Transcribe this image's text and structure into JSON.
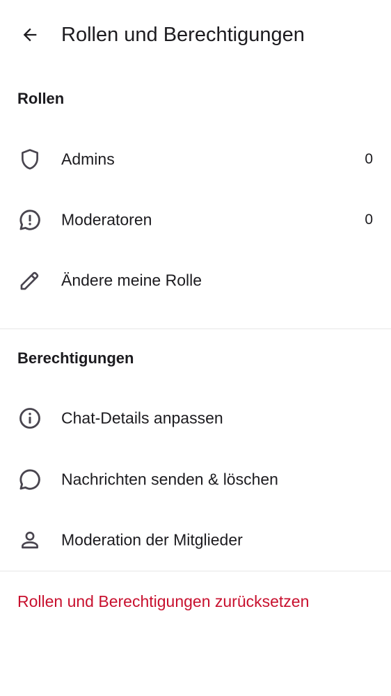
{
  "header": {
    "title": "Rollen und Berechtigungen",
    "back_icon": "arrow-back-icon"
  },
  "roles": {
    "header": "Rollen",
    "items": [
      {
        "icon": "shield-icon",
        "label": "Admins",
        "count": "0"
      },
      {
        "icon": "alert-chat-icon",
        "label": "Moderatoren",
        "count": "0"
      },
      {
        "icon": "pencil-icon",
        "label": "Ändere meine Rolle"
      }
    ]
  },
  "permissions": {
    "header": "Berechtigungen",
    "items": [
      {
        "icon": "info-icon",
        "label": "Chat-Details anpassen"
      },
      {
        "icon": "chat-bubble-icon",
        "label": "Nachrichten senden & löschen"
      },
      {
        "icon": "person-icon",
        "label": "Moderation der Mitglieder"
      }
    ]
  },
  "reset": {
    "label": "Rollen und Berechtigungen zurücksetzen"
  },
  "colors": {
    "text": "#1c1b1f",
    "icon": "#49454f",
    "danger": "#c8102e",
    "divider": "#e6e6e6"
  }
}
